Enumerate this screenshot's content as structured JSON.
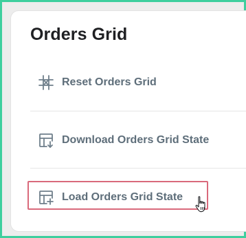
{
  "panel": {
    "title": "Orders Grid"
  },
  "menu": {
    "items": [
      {
        "label": "Reset Orders Grid",
        "icon": "grid-reset-icon"
      },
      {
        "label": "Download Orders Grid State",
        "icon": "table-download-icon"
      },
      {
        "label": "Load Orders Grid State",
        "icon": "table-add-icon"
      }
    ]
  },
  "colors": {
    "frame_border": "#3ecf9e",
    "highlight_border": "#d9697b",
    "label_text": "#5e6e7a",
    "title_text": "#1f2023"
  },
  "cursor": {
    "icon": "hand-pointer-icon"
  }
}
